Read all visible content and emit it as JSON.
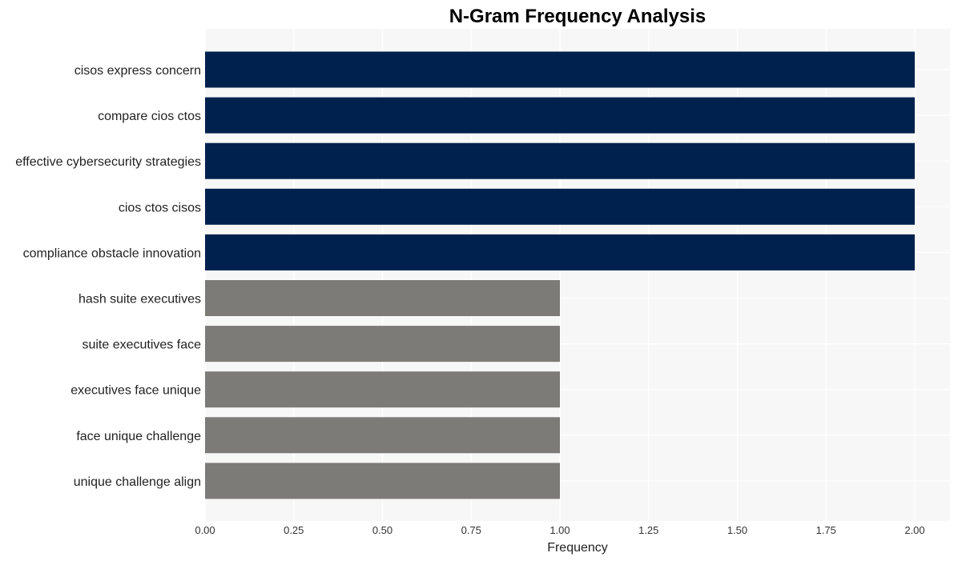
{
  "chart_data": {
    "type": "bar",
    "orientation": "horizontal",
    "title": "N-Gram Frequency Analysis",
    "xlabel": "Frequency",
    "ylabel": "",
    "categories": [
      "cisos express concern",
      "compare cios ctos",
      "effective cybersecurity strategies",
      "cios ctos cisos",
      "compliance obstacle innovation",
      "hash suite executives",
      "suite executives face",
      "executives face unique",
      "face unique challenge",
      "unique challenge align"
    ],
    "values": [
      2,
      2,
      2,
      2,
      2,
      1,
      1,
      1,
      1,
      1
    ],
    "bar_colors": [
      "#00214d",
      "#00214d",
      "#00214d",
      "#00214d",
      "#00214d",
      "#7d7b77",
      "#7d7b77",
      "#7d7b77",
      "#7d7b77",
      "#7d7b77"
    ],
    "xlim": [
      0,
      2.1
    ],
    "xticks": [
      0,
      0.25,
      0.5,
      0.75,
      1.0,
      1.25,
      1.5,
      1.75,
      2.0
    ],
    "xtick_labels": [
      "0.00",
      "0.25",
      "0.50",
      "0.75",
      "1.00",
      "1.25",
      "1.50",
      "1.75",
      "2.00"
    ],
    "grid": true,
    "legend": "none",
    "panel_background": "#f7f7f7",
    "grid_color": "#ffffff"
  }
}
